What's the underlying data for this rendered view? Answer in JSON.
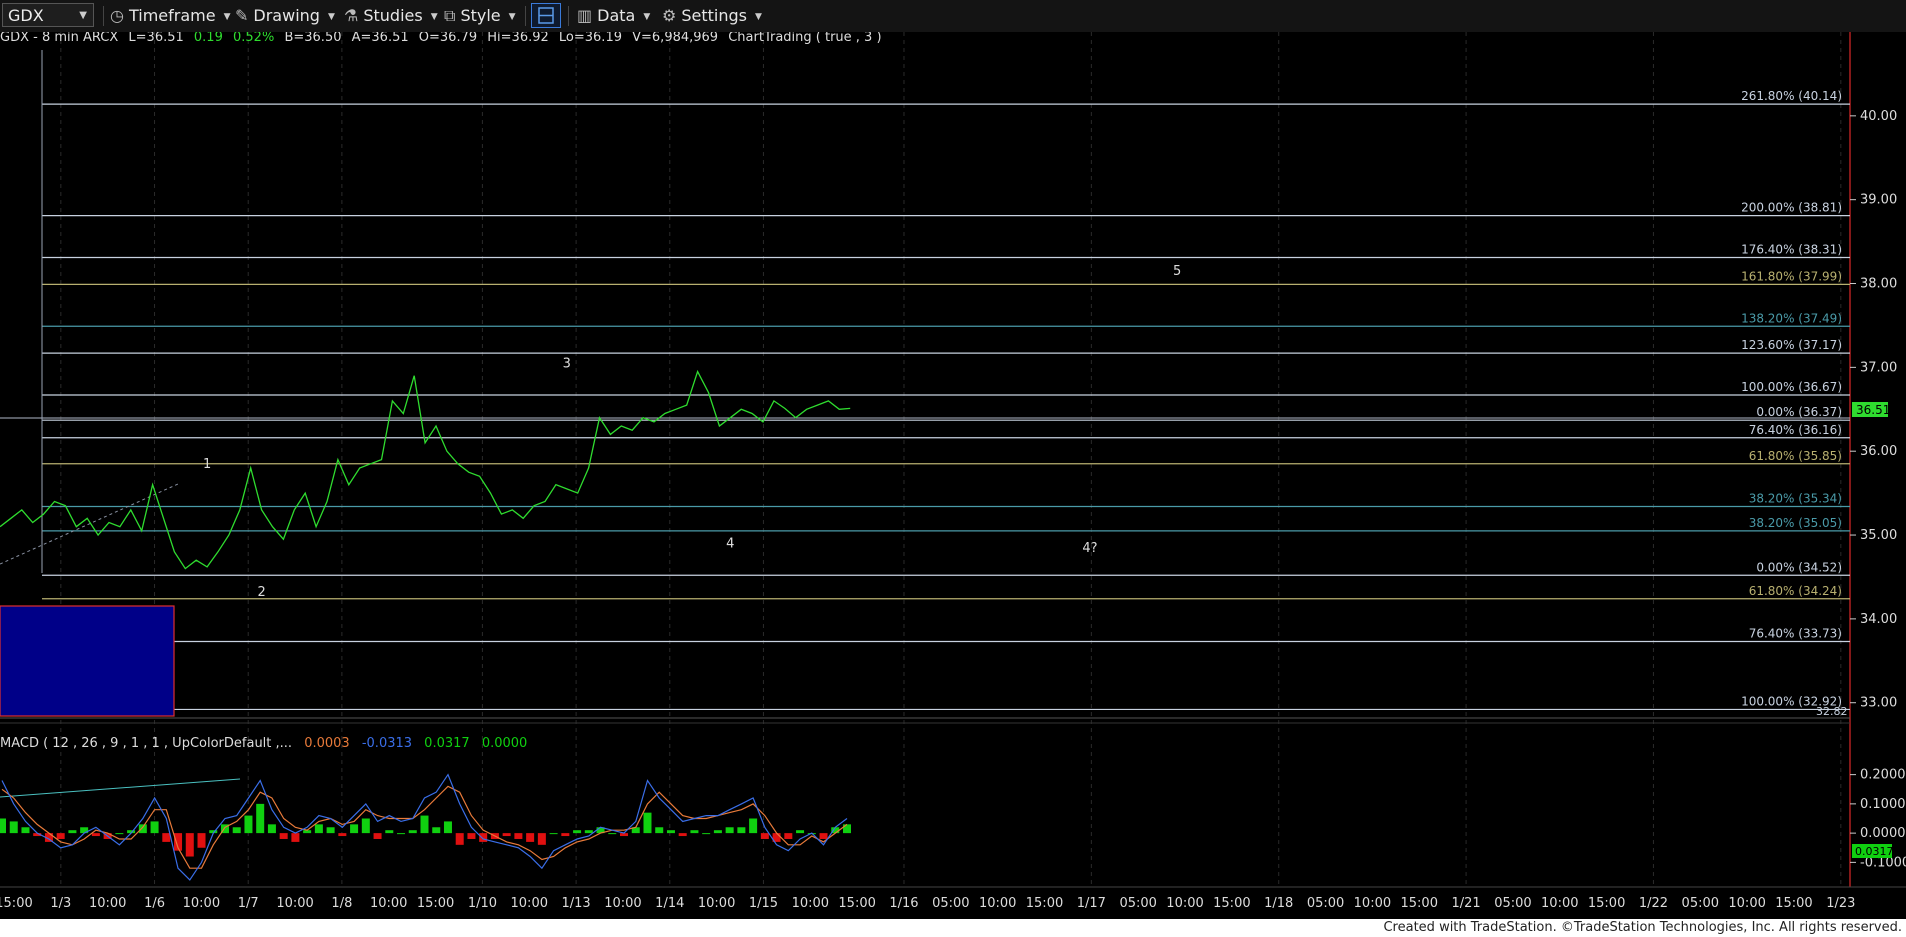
{
  "toolbar": {
    "symbol": "GDX",
    "timeframe": "Timeframe",
    "drawing": "Drawing",
    "studies": "Studies",
    "style": "Style",
    "data": "Data",
    "settings": "Settings"
  },
  "header": {
    "symbol_info": "GDX - 8 min  ARCX",
    "last": "L=36.51",
    "change": "0.19",
    "change_pct": "0.52%",
    "bid": "B=36.50",
    "ask": "A=36.51",
    "open": "O=36.79",
    "high": "Hi=36.92",
    "low": "Lo=36.19",
    "volume": "V=6,984,969",
    "study": "ChartTrading ( true , 3 )"
  },
  "colors": {
    "price": "#2fdc2f",
    "fib_white": "#c8d2e0",
    "fib_olive": "#b8b070",
    "fib_teal": "#4a9aa8",
    "macd_line": "#3a6ee8",
    "signal_line": "#e87a3a",
    "hist_pos": "#10d010",
    "hist_neg": "#e01010",
    "box_fill": "#000088",
    "box_border": "#e03030"
  },
  "chart_data": {
    "type": "line",
    "title": "GDX - 8 min",
    "price_ylim": [
      32.77,
      41.0
    ],
    "price_ticks": [
      "40.00",
      "39.00",
      "38.00",
      "37.00",
      "36.00",
      "35.00",
      "34.00",
      "33.00"
    ],
    "last_price": "36.51",
    "low_marker": "32.82",
    "x_labels": [
      "15:00",
      "1/3",
      "10:00",
      "1/6",
      "10:00",
      "1/7",
      "10:00",
      "1/8",
      "10:00",
      "15:00",
      "1/10",
      "10:00",
      "1/13",
      "10:00",
      "1/14",
      "10:00",
      "1/15",
      "10:00",
      "15:00",
      "1/16",
      "05:00",
      "10:00",
      "15:00",
      "1/17",
      "05:00",
      "10:00",
      "15:00",
      "1/18",
      "05:00",
      "10:00",
      "15:00",
      "1/21",
      "05:00",
      "10:00",
      "15:00",
      "1/22",
      "05:00",
      "10:00",
      "15:00",
      "1/23"
    ],
    "price_series": {
      "x": [
        0,
        1,
        2,
        3,
        4,
        5,
        6,
        7,
        8,
        9,
        10,
        11,
        12,
        13,
        14,
        15,
        16,
        17,
        18,
        19,
        20,
        21,
        22,
        23,
        24,
        25,
        26,
        27,
        28,
        29,
        30,
        31,
        32,
        33,
        34,
        35,
        36,
        37,
        38,
        39,
        40,
        41,
        42,
        43,
        44,
        45,
        46,
        47,
        48,
        49,
        50,
        51,
        52,
        53,
        54,
        55,
        56,
        57,
        58,
        59,
        60,
        61,
        62,
        63,
        64,
        65,
        66,
        67,
        68,
        69,
        70,
        71,
        72,
        73,
        74,
        75,
        76,
        77,
        78
      ],
      "y": [
        35.1,
        35.2,
        35.3,
        35.15,
        35.25,
        35.4,
        35.35,
        35.1,
        35.2,
        35.0,
        35.15,
        35.1,
        35.3,
        35.05,
        35.6,
        35.2,
        34.8,
        34.6,
        34.7,
        34.62,
        34.8,
        35.0,
        35.3,
        35.8,
        35.3,
        35.1,
        34.95,
        35.3,
        35.5,
        35.1,
        35.4,
        35.9,
        35.6,
        35.8,
        35.85,
        35.9,
        36.6,
        36.45,
        36.9,
        36.1,
        36.3,
        36.0,
        35.85,
        35.75,
        35.7,
        35.5,
        35.25,
        35.3,
        35.2,
        35.35,
        35.4,
        35.6,
        35.55,
        35.5,
        35.8,
        36.4,
        36.2,
        36.3,
        36.25,
        36.4,
        36.35,
        36.45,
        36.5,
        36.55,
        36.95,
        36.7,
        36.3,
        36.4,
        36.5,
        36.45,
        36.35,
        36.6,
        36.51,
        36.4,
        36.5,
        36.55,
        36.6,
        36.5,
        36.51
      ]
    },
    "fib_levels": [
      {
        "label": "261.80% (40.14)",
        "value": 40.14,
        "color": "white"
      },
      {
        "label": "200.00% (38.81)",
        "value": 38.81,
        "color": "white"
      },
      {
        "label": "176.40% (38.31)",
        "value": 38.31,
        "color": "white"
      },
      {
        "label": "161.80% (37.99)",
        "value": 37.99,
        "color": "olive"
      },
      {
        "label": "138.20% (37.49)",
        "value": 37.49,
        "color": "teal"
      },
      {
        "label": "123.60% (37.17)",
        "value": 37.17,
        "color": "white"
      },
      {
        "label": "100.00% (36.67)",
        "value": 36.67,
        "color": "white"
      },
      {
        "label": "0.00% (36.37)",
        "value": 36.37,
        "color": "white"
      },
      {
        "label": "76.40% (36.16)",
        "value": 36.16,
        "color": "white"
      },
      {
        "label": "61.80% (35.85)",
        "value": 35.85,
        "color": "olive"
      },
      {
        "label": "38.20% (35.34)",
        "value": 35.34,
        "color": "teal"
      },
      {
        "label": "38.20% (35.05)",
        "value": 35.05,
        "color": "teal"
      },
      {
        "label": "0.00% (34.52)",
        "value": 34.52,
        "color": "white"
      },
      {
        "label": "61.80% (34.24)",
        "value": 34.24,
        "color": "olive"
      },
      {
        "label": "76.40% (33.73)",
        "value": 33.73,
        "color": "white"
      },
      {
        "label": "100.00% (32.92)",
        "value": 32.92,
        "color": "white"
      }
    ],
    "wave_labels": [
      {
        "text": "1",
        "x": 19,
        "y": 35.8
      },
      {
        "text": "2",
        "x": 24,
        "y": 34.27
      },
      {
        "text": "3",
        "x": 52,
        "y": 37.0
      },
      {
        "text": "4",
        "x": 67,
        "y": 34.85
      },
      {
        "text": "5",
        "x": 108,
        "y": 38.1
      },
      {
        "text": "4?",
        "x": 100,
        "y": 34.8
      }
    ],
    "macd": {
      "label": "MACD ( 12 , 26 , 9 , 1 , 1 , UpColorDefault ,...",
      "value_1": "0.0003",
      "value_2": "-0.0313",
      "value_3": "0.0317",
      "value_4": "0.0000",
      "ylim": [
        -0.15,
        0.25
      ],
      "ticks": [
        "0.2000",
        "0.1000",
        "0.0000",
        "-0.1000"
      ],
      "last_value": "0.0317",
      "histogram": [
        0.05,
        0.04,
        0.02,
        -0.01,
        -0.03,
        -0.02,
        0.01,
        0.02,
        -0.01,
        -0.02,
        0.0,
        0.01,
        0.03,
        0.04,
        -0.03,
        -0.06,
        -0.08,
        -0.05,
        0.01,
        0.03,
        0.02,
        0.06,
        0.1,
        0.03,
        -0.02,
        -0.03,
        0.01,
        0.03,
        0.02,
        -0.01,
        0.03,
        0.05,
        -0.02,
        0.01,
        0.0,
        0.01,
        0.06,
        0.02,
        0.04,
        -0.04,
        -0.02,
        -0.03,
        -0.02,
        -0.01,
        -0.02,
        -0.03,
        -0.04,
        0.0,
        -0.01,
        0.01,
        0.01,
        0.02,
        0.0,
        -0.01,
        0.02,
        0.07,
        0.02,
        0.01,
        -0.01,
        0.01,
        0.0,
        0.01,
        0.02,
        0.02,
        0.05,
        -0.02,
        -0.03,
        -0.02,
        0.01,
        0.0,
        -0.02,
        0.02,
        0.03
      ],
      "macd_line": [
        0.18,
        0.1,
        0.04,
        0.0,
        -0.02,
        -0.05,
        -0.04,
        0.0,
        0.02,
        -0.01,
        -0.04,
        0.0,
        0.05,
        0.12,
        0.05,
        -0.12,
        -0.16,
        -0.1,
        0.0,
        0.05,
        0.06,
        0.12,
        0.18,
        0.08,
        0.02,
        0.0,
        0.02,
        0.06,
        0.05,
        0.02,
        0.06,
        0.1,
        0.04,
        0.06,
        0.04,
        0.05,
        0.12,
        0.14,
        0.2,
        0.1,
        0.02,
        -0.02,
        -0.03,
        -0.04,
        -0.05,
        -0.08,
        -0.12,
        -0.06,
        -0.04,
        -0.02,
        -0.01,
        0.02,
        0.01,
        0.0,
        0.04,
        0.18,
        0.12,
        0.08,
        0.04,
        0.05,
        0.06,
        0.06,
        0.08,
        0.1,
        0.12,
        0.02,
        -0.04,
        -0.06,
        -0.02,
        0.0,
        -0.04,
        0.02,
        0.05
      ],
      "signal_line": [
        0.15,
        0.12,
        0.07,
        0.03,
        0.0,
        -0.03,
        -0.04,
        -0.02,
        0.01,
        0.0,
        -0.02,
        -0.02,
        0.02,
        0.08,
        0.08,
        -0.05,
        -0.12,
        -0.12,
        -0.04,
        0.02,
        0.04,
        0.08,
        0.14,
        0.12,
        0.05,
        0.02,
        0.01,
        0.04,
        0.05,
        0.03,
        0.04,
        0.08,
        0.06,
        0.05,
        0.05,
        0.05,
        0.08,
        0.12,
        0.16,
        0.14,
        0.06,
        0.01,
        -0.01,
        -0.03,
        -0.04,
        -0.06,
        -0.09,
        -0.08,
        -0.05,
        -0.03,
        -0.02,
        0.0,
        0.01,
        0.01,
        0.02,
        0.1,
        0.14,
        0.1,
        0.06,
        0.05,
        0.05,
        0.06,
        0.07,
        0.08,
        0.1,
        0.06,
        0.0,
        -0.04,
        -0.04,
        -0.01,
        -0.03,
        0.0,
        0.03
      ]
    }
  },
  "footer": {
    "credit": "Created with TradeStation. ©TradeStation Technologies, Inc. All rights reserved."
  }
}
